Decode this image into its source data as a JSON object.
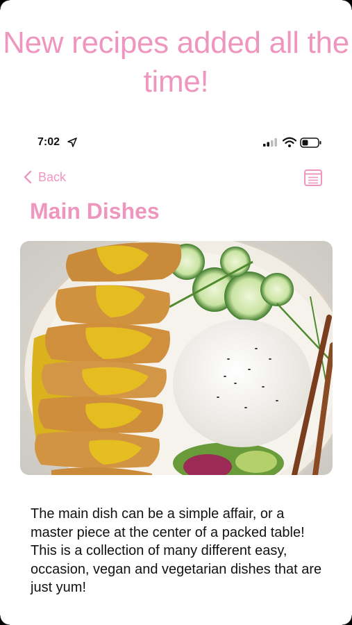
{
  "promo": {
    "headline": "New recipes added all the time!"
  },
  "status_bar": {
    "time": "7:02",
    "icons": [
      "location-arrow-icon",
      "cellular-signal-icon",
      "wifi-icon",
      "battery-icon"
    ]
  },
  "nav": {
    "back_label": "Back",
    "back_icon": "chevron-left-icon",
    "menu_icon": "list-icon"
  },
  "page": {
    "title": "Main Dishes",
    "image_subject": "breaded chicken cutlets with curry sauce, rice, cucumber salad and chopsticks",
    "description": "The main dish can be a simple affair, or a master piece at the center of a packed table! This is a collection of many different easy, occasion, vegan and vegetarian dishes that are just yum!"
  },
  "colors": {
    "accent_pink": "#ef96bf",
    "text": "#111111",
    "background": "#ffffff"
  }
}
